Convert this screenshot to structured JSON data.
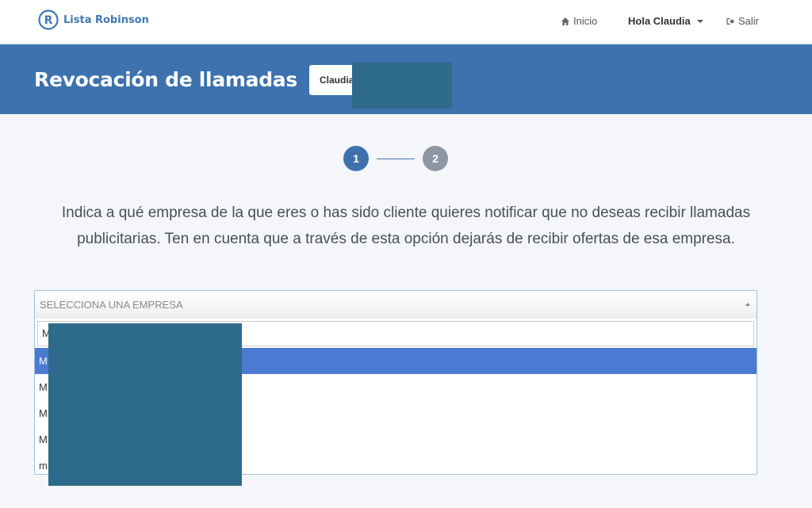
{
  "brand": {
    "name": "Lista Robinson",
    "logo_letter": "R",
    "color": "#3f79b3"
  },
  "nav": {
    "inicio_label": "Inicio",
    "user_label": "Hola Claudia",
    "logout_label": "Salir"
  },
  "header": {
    "title": "Revocación de llamadas",
    "user_name": "Claudia"
  },
  "steps": [
    {
      "label": "1",
      "state": "active",
      "color": "#3f72ad"
    },
    {
      "label": "2",
      "state": "pending",
      "color": "#8d97a3"
    }
  ],
  "instructions": "Indica a qué empresa de la que eres o has sido cliente quieres notificar que no deseas recibir llamadas publicitarias. Ten en cuenta que a través de esta opción dejarás de recibir ofertas de esa empresa.",
  "select": {
    "placeholder": "SELECCIONA UNA EMPRESA",
    "search_value": "M",
    "options": [
      {
        "label": "M",
        "selected": true
      },
      {
        "label": "M",
        "selected": false
      },
      {
        "label": "M",
        "selected": false
      },
      {
        "label": "M",
        "selected": false
      },
      {
        "label": "m",
        "selected": false
      }
    ]
  },
  "colors": {
    "band": "#3d72ae",
    "option_highlight": "#4a7ad2",
    "redaction": "#2e6a8c"
  }
}
